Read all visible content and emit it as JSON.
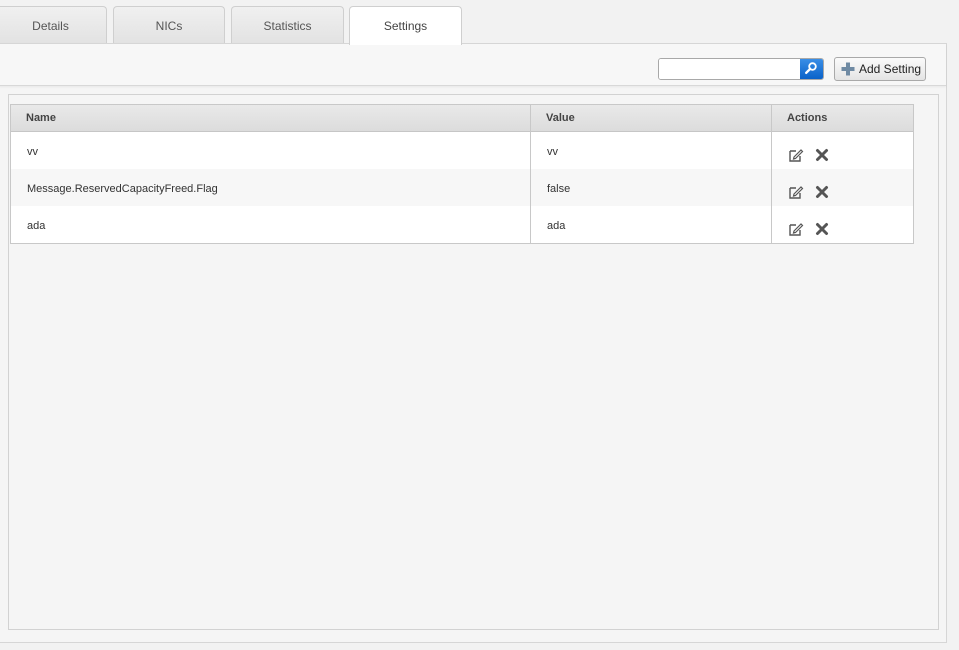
{
  "tabs": [
    {
      "label": "Details",
      "active": false
    },
    {
      "label": "NICs",
      "active": false
    },
    {
      "label": "Statistics",
      "active": false
    },
    {
      "label": "Settings",
      "active": true
    }
  ],
  "toolbar": {
    "search_value": "",
    "search_icon": "search-icon",
    "add_label": "Add Setting",
    "add_icon": "plus-icon"
  },
  "grid": {
    "columns": [
      "Name",
      "Value",
      "Actions"
    ],
    "rows": [
      {
        "name": "vv",
        "value": "vv"
      },
      {
        "name": "Message.ReservedCapacityFreed.Flag",
        "value": "false"
      },
      {
        "name": "ada",
        "value": "ada"
      }
    ],
    "row_actions": [
      "edit-icon",
      "delete-icon"
    ]
  },
  "colors": {
    "accent": "#1572d6",
    "border": "#c8c8c8",
    "background": "#f5f5f5"
  }
}
